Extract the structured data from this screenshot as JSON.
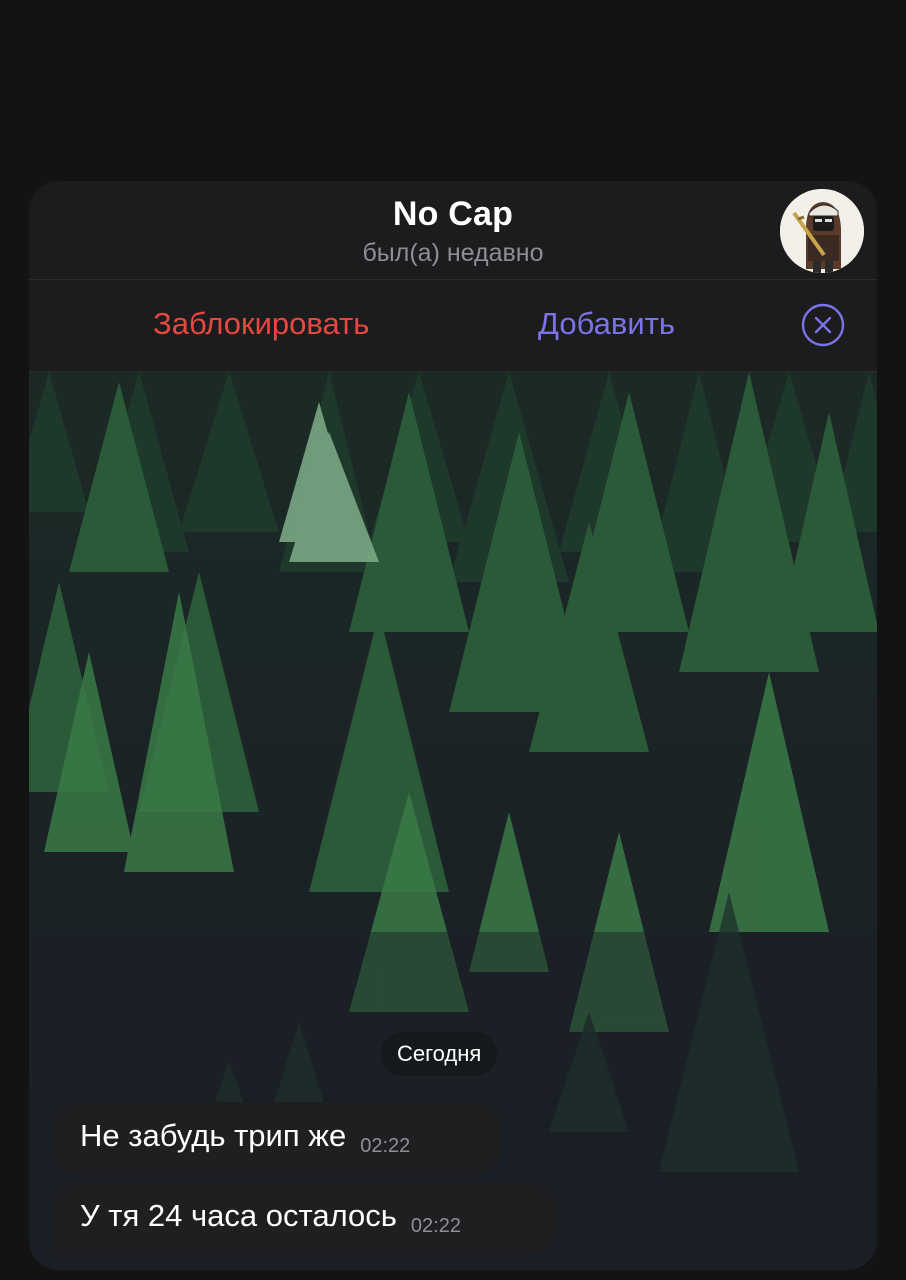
{
  "header": {
    "title": "No Cap",
    "status": "был(а) недавно",
    "avatar_icon": "avatar-character-icon"
  },
  "actions": {
    "block_label": "Заблокировать",
    "add_label": "Добавить",
    "close_icon": "close-circle-icon",
    "block_color": "#e5483f",
    "add_color": "#7b73e8"
  },
  "chat": {
    "date_label": "Сегодня",
    "messages": [
      {
        "text": "Не забудь трип же",
        "time": "02:22"
      },
      {
        "text": "У тя 24 часа осталось",
        "time": "02:22"
      }
    ]
  }
}
